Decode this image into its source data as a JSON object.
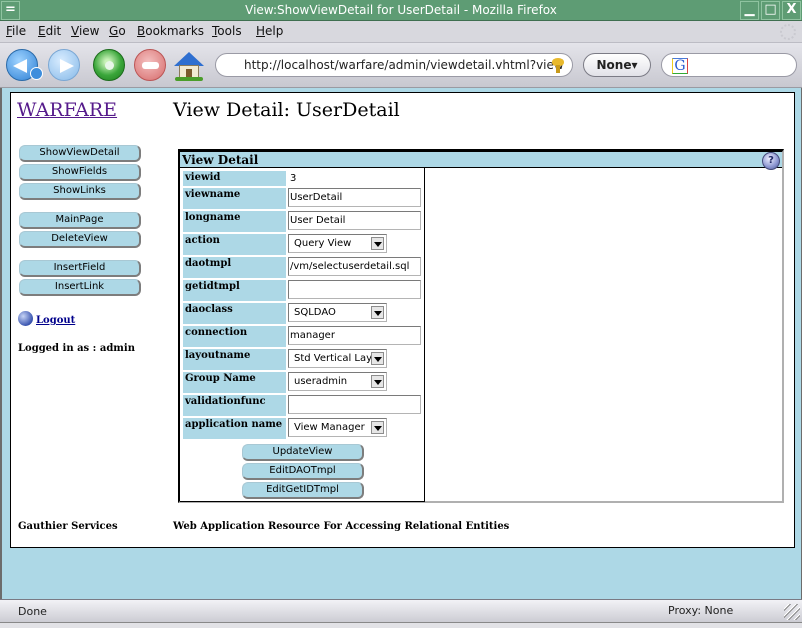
{
  "window": {
    "title": "View:ShowViewDetail for UserDetail - Mozilla Firefox",
    "minimize_glyph": "▁",
    "maximize_glyph": "□",
    "close_glyph": "X",
    "menu_glyph": "="
  },
  "menubar": {
    "items": [
      "File",
      "Edit",
      "View",
      "Go",
      "Bookmarks",
      "Tools",
      "Help"
    ]
  },
  "toolbar": {
    "url": "http://localhost/warfare/admin/viewdetail.vhtml?view",
    "proxy_button": "None▾",
    "search_engine_glyph": "G",
    "search_placeholder": ""
  },
  "page": {
    "brand": "WARFARE",
    "title": "View Detail: UserDetail",
    "sidebar": {
      "groups": [
        [
          "ShowViewDetail",
          "ShowFields",
          "ShowLinks"
        ],
        [
          "MainPage",
          "DeleteView"
        ],
        [
          "InsertField",
          "InsertLink"
        ]
      ],
      "logout": "Logout",
      "logged_in": "Logged in as : admin"
    },
    "panel": {
      "title": "View Detail",
      "help_glyph": "?",
      "fields": [
        {
          "label": "viewid",
          "type": "static",
          "value": "3"
        },
        {
          "label": "viewname",
          "type": "text",
          "value": "UserDetail"
        },
        {
          "label": "longname",
          "type": "text",
          "value": "User Detail"
        },
        {
          "label": "action",
          "type": "select",
          "value": "Query View"
        },
        {
          "label": "daotmpl",
          "type": "text",
          "value": "/vm/selectuserdetail.sql"
        },
        {
          "label": "getidtmpl",
          "type": "text",
          "value": ""
        },
        {
          "label": "daoclass",
          "type": "select",
          "value": "SQLDAO"
        },
        {
          "label": "connection",
          "type": "text",
          "value": "manager"
        },
        {
          "label": "layoutname",
          "type": "select",
          "value": "Std Vertical Lay"
        },
        {
          "label": "Group Name",
          "type": "select",
          "value": "useradmin"
        },
        {
          "label": "validationfunc",
          "type": "text",
          "value": ""
        },
        {
          "label": "application name",
          "type": "select",
          "value": "View Manager"
        }
      ],
      "buttons": [
        "UpdateView",
        "EditDAOTmpl",
        "EditGetIDTmpl"
      ]
    },
    "footer": {
      "left": "Gauthier Services",
      "right": "Web Application Resource For Accessing Relational Entities"
    }
  },
  "statusbar": {
    "status": "Done",
    "proxy": "Proxy: None"
  }
}
